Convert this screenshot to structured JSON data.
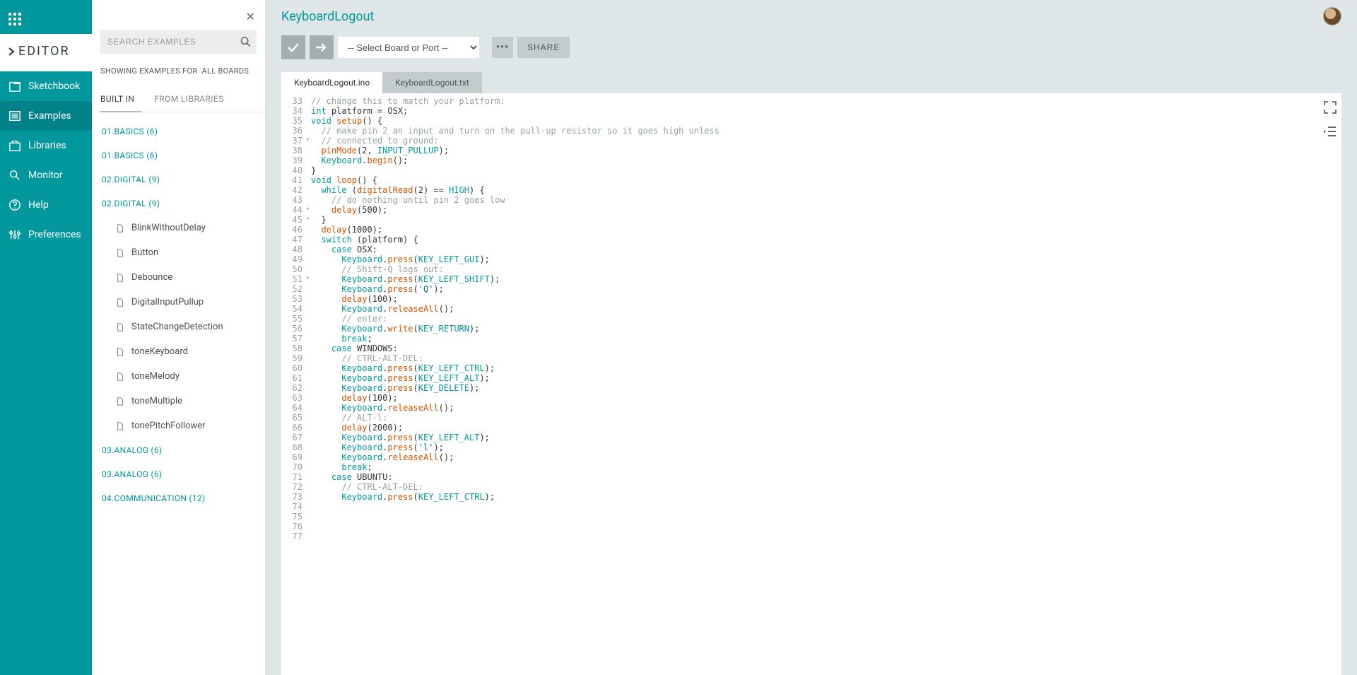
{
  "brand": "EDITOR",
  "nav": [
    {
      "id": "sketchbook",
      "label": "Sketchbook"
    },
    {
      "id": "examples",
      "label": "Examples"
    },
    {
      "id": "libraries",
      "label": "Libraries"
    },
    {
      "id": "monitor",
      "label": "Monitor"
    },
    {
      "id": "help",
      "label": "Help"
    },
    {
      "id": "preferences",
      "label": "Preferences"
    }
  ],
  "nav_active": "examples",
  "search": {
    "placeholder": "SEARCH EXAMPLES"
  },
  "showing": {
    "prefix": "SHOWING EXAMPLES FOR",
    "target": "ALL BOARDS"
  },
  "panel_tabs": {
    "builtin": "BUILT IN",
    "fromlib": "FROM LIBRARIES",
    "active": "builtin"
  },
  "tree": [
    {
      "type": "cat",
      "label": "01.BASICS (6)"
    },
    {
      "type": "cat",
      "label": "01.BASICS (6)"
    },
    {
      "type": "cat",
      "label": "02.DIGITAL (9)"
    },
    {
      "type": "cat",
      "label": "02.DIGITAL (9)"
    },
    {
      "type": "leaf",
      "label": "BlinkWithoutDelay"
    },
    {
      "type": "leaf",
      "label": "Button"
    },
    {
      "type": "leaf",
      "label": "Debounce"
    },
    {
      "type": "leaf",
      "label": "DigitalInputPullup"
    },
    {
      "type": "leaf",
      "label": "StateChangeDetection"
    },
    {
      "type": "leaf",
      "label": "toneKeyboard"
    },
    {
      "type": "leaf",
      "label": "toneMelody"
    },
    {
      "type": "leaf",
      "label": "toneMultiple"
    },
    {
      "type": "leaf",
      "label": "tonePitchFollower"
    },
    {
      "type": "cat",
      "label": "03.ANALOG (6)"
    },
    {
      "type": "cat",
      "label": "03.ANALOG (6)"
    },
    {
      "type": "cat",
      "label": "04.COMMUNICATION (12)"
    }
  ],
  "title": "KeyboardLogout",
  "board_select": "-- Select Board or Port --",
  "share_label": "SHARE",
  "file_tabs": [
    {
      "id": "ino",
      "label": "KeyboardLogout.ino"
    },
    {
      "id": "txt",
      "label": "KeyboardLogout.txt"
    }
  ],
  "file_tab_active": "ino",
  "code": {
    "first_line": 33,
    "fold_lines": [
      37,
      44,
      45,
      51
    ],
    "lines": [
      {
        "n": 33,
        "t": [
          [
            "",
            ""
          ]
        ]
      },
      {
        "n": 34,
        "t": [
          [
            "c-comment",
            "// change this to match your platform:"
          ]
        ]
      },
      {
        "n": 35,
        "t": [
          [
            "c-type",
            "int"
          ],
          [
            "",
            " platform = OSX;"
          ]
        ]
      },
      {
        "n": 36,
        "t": [
          [
            "",
            ""
          ]
        ]
      },
      {
        "n": 37,
        "t": [
          [
            "c-type",
            "void"
          ],
          [
            "",
            " "
          ],
          [
            "c-func",
            "setup"
          ],
          [
            "",
            "() {"
          ]
        ]
      },
      {
        "n": 38,
        "t": [
          [
            "",
            "  "
          ],
          [
            "c-comment",
            "// make pin 2 an input and turn on the pull-up resistor so it goes high unless"
          ]
        ]
      },
      {
        "n": 39,
        "t": [
          [
            "",
            "  "
          ],
          [
            "c-comment",
            "// connected to ground:"
          ]
        ]
      },
      {
        "n": 40,
        "t": [
          [
            "",
            "  "
          ],
          [
            "c-func",
            "pinMode"
          ],
          [
            "",
            "(2, "
          ],
          [
            "c-const",
            "INPUT_PULLUP"
          ],
          [
            "",
            ");"
          ]
        ]
      },
      {
        "n": 41,
        "t": [
          [
            "",
            "  "
          ],
          [
            "c-const",
            "Keyboard"
          ],
          [
            "",
            "."
          ],
          [
            "c-func",
            "begin"
          ],
          [
            "",
            "();"
          ]
        ]
      },
      {
        "n": 42,
        "t": [
          [
            "",
            "}"
          ]
        ]
      },
      {
        "n": 43,
        "t": [
          [
            "",
            ""
          ]
        ]
      },
      {
        "n": 44,
        "t": [
          [
            "c-type",
            "void"
          ],
          [
            "",
            " "
          ],
          [
            "c-func",
            "loop"
          ],
          [
            "",
            "() {"
          ]
        ]
      },
      {
        "n": 45,
        "t": [
          [
            "",
            "  "
          ],
          [
            "c-keyword",
            "while"
          ],
          [
            "",
            " ("
          ],
          [
            "c-func",
            "digitalRead"
          ],
          [
            "",
            "(2) == "
          ],
          [
            "c-const",
            "HIGH"
          ],
          [
            "",
            ") {"
          ]
        ]
      },
      {
        "n": 46,
        "t": [
          [
            "",
            "    "
          ],
          [
            "c-comment",
            "// do nothing until pin 2 goes low"
          ]
        ]
      },
      {
        "n": 47,
        "t": [
          [
            "",
            "    "
          ],
          [
            "c-func",
            "delay"
          ],
          [
            "",
            "(500);"
          ]
        ]
      },
      {
        "n": 48,
        "t": [
          [
            "",
            "  }"
          ]
        ]
      },
      {
        "n": 49,
        "t": [
          [
            "",
            "  "
          ],
          [
            "c-func",
            "delay"
          ],
          [
            "",
            "(1000);"
          ]
        ]
      },
      {
        "n": 50,
        "t": [
          [
            "",
            ""
          ]
        ]
      },
      {
        "n": 51,
        "t": [
          [
            "",
            "  "
          ],
          [
            "c-keyword",
            "switch"
          ],
          [
            "",
            " (platform) {"
          ]
        ]
      },
      {
        "n": 52,
        "t": [
          [
            "",
            "    "
          ],
          [
            "c-keyword",
            "case"
          ],
          [
            "",
            " OSX:"
          ]
        ]
      },
      {
        "n": 53,
        "t": [
          [
            "",
            "      "
          ],
          [
            "c-const",
            "Keyboard"
          ],
          [
            "",
            "."
          ],
          [
            "c-func",
            "press"
          ],
          [
            "",
            "("
          ],
          [
            "c-const",
            "KEY_LEFT_GUI"
          ],
          [
            "",
            ");"
          ]
        ]
      },
      {
        "n": 54,
        "t": [
          [
            "",
            "      "
          ],
          [
            "c-comment",
            "// Shift-Q logs out:"
          ]
        ]
      },
      {
        "n": 55,
        "t": [
          [
            "",
            "      "
          ],
          [
            "c-const",
            "Keyboard"
          ],
          [
            "",
            "."
          ],
          [
            "c-func",
            "press"
          ],
          [
            "",
            "("
          ],
          [
            "c-const",
            "KEY_LEFT_SHIFT"
          ],
          [
            "",
            ");"
          ]
        ]
      },
      {
        "n": 56,
        "t": [
          [
            "",
            "      "
          ],
          [
            "c-const",
            "Keyboard"
          ],
          [
            "",
            "."
          ],
          [
            "c-func",
            "press"
          ],
          [
            "",
            "("
          ],
          [
            "c-string",
            "'Q'"
          ],
          [
            "",
            ");"
          ]
        ]
      },
      {
        "n": 57,
        "t": [
          [
            "",
            "      "
          ],
          [
            "c-func",
            "delay"
          ],
          [
            "",
            "(100);"
          ]
        ]
      },
      {
        "n": 58,
        "t": [
          [
            "",
            "      "
          ],
          [
            "c-const",
            "Keyboard"
          ],
          [
            "",
            "."
          ],
          [
            "c-func",
            "releaseAll"
          ],
          [
            "",
            "();"
          ]
        ]
      },
      {
        "n": 59,
        "t": [
          [
            "",
            "      "
          ],
          [
            "c-comment",
            "// enter:"
          ]
        ]
      },
      {
        "n": 60,
        "t": [
          [
            "",
            "      "
          ],
          [
            "c-const",
            "Keyboard"
          ],
          [
            "",
            "."
          ],
          [
            "c-func",
            "write"
          ],
          [
            "",
            "("
          ],
          [
            "c-const",
            "KEY_RETURN"
          ],
          [
            "",
            ");"
          ]
        ]
      },
      {
        "n": 61,
        "t": [
          [
            "",
            "      "
          ],
          [
            "c-keyword",
            "break"
          ],
          [
            "",
            ";"
          ]
        ]
      },
      {
        "n": 62,
        "t": [
          [
            "",
            "    "
          ],
          [
            "c-keyword",
            "case"
          ],
          [
            "",
            " WINDOWS:"
          ]
        ]
      },
      {
        "n": 63,
        "t": [
          [
            "",
            "      "
          ],
          [
            "c-comment",
            "// CTRL-ALT-DEL:"
          ]
        ]
      },
      {
        "n": 64,
        "t": [
          [
            "",
            "      "
          ],
          [
            "c-const",
            "Keyboard"
          ],
          [
            "",
            "."
          ],
          [
            "c-func",
            "press"
          ],
          [
            "",
            "("
          ],
          [
            "c-const",
            "KEY_LEFT_CTRL"
          ],
          [
            "",
            ");"
          ]
        ]
      },
      {
        "n": 65,
        "t": [
          [
            "",
            "      "
          ],
          [
            "c-const",
            "Keyboard"
          ],
          [
            "",
            "."
          ],
          [
            "c-func",
            "press"
          ],
          [
            "",
            "("
          ],
          [
            "c-const",
            "KEY_LEFT_ALT"
          ],
          [
            "",
            ");"
          ]
        ]
      },
      {
        "n": 66,
        "t": [
          [
            "",
            "      "
          ],
          [
            "c-const",
            "Keyboard"
          ],
          [
            "",
            "."
          ],
          [
            "c-func",
            "press"
          ],
          [
            "",
            "("
          ],
          [
            "c-const",
            "KEY_DELETE"
          ],
          [
            "",
            ");"
          ]
        ]
      },
      {
        "n": 67,
        "t": [
          [
            "",
            "      "
          ],
          [
            "c-func",
            "delay"
          ],
          [
            "",
            "(100);"
          ]
        ]
      },
      {
        "n": 68,
        "t": [
          [
            "",
            "      "
          ],
          [
            "c-const",
            "Keyboard"
          ],
          [
            "",
            "."
          ],
          [
            "c-func",
            "releaseAll"
          ],
          [
            "",
            "();"
          ]
        ]
      },
      {
        "n": 69,
        "t": [
          [
            "",
            "      "
          ],
          [
            "c-comment",
            "// ALT-l:"
          ]
        ]
      },
      {
        "n": 70,
        "t": [
          [
            "",
            "      "
          ],
          [
            "c-func",
            "delay"
          ],
          [
            "",
            "(2000);"
          ]
        ]
      },
      {
        "n": 71,
        "t": [
          [
            "",
            "      "
          ],
          [
            "c-const",
            "Keyboard"
          ],
          [
            "",
            "."
          ],
          [
            "c-func",
            "press"
          ],
          [
            "",
            "("
          ],
          [
            "c-const",
            "KEY_LEFT_ALT"
          ],
          [
            "",
            ");"
          ]
        ]
      },
      {
        "n": 72,
        "t": [
          [
            "",
            "      "
          ],
          [
            "c-const",
            "Keyboard"
          ],
          [
            "",
            "."
          ],
          [
            "c-func",
            "press"
          ],
          [
            "",
            "("
          ],
          [
            "c-string",
            "'l'"
          ],
          [
            "",
            ");"
          ]
        ]
      },
      {
        "n": 73,
        "t": [
          [
            "",
            "      "
          ],
          [
            "c-const",
            "Keyboard"
          ],
          [
            "",
            "."
          ],
          [
            "c-func",
            "releaseAll"
          ],
          [
            "",
            "();"
          ]
        ]
      },
      {
        "n": 74,
        "t": [
          [
            "",
            "      "
          ],
          [
            "c-keyword",
            "break"
          ],
          [
            "",
            ";"
          ]
        ]
      },
      {
        "n": 75,
        "t": [
          [
            "",
            "    "
          ],
          [
            "c-keyword",
            "case"
          ],
          [
            "",
            " UBUNTU:"
          ]
        ]
      },
      {
        "n": 76,
        "t": [
          [
            "",
            "      "
          ],
          [
            "c-comment",
            "// CTRL-ALT-DEL:"
          ]
        ]
      },
      {
        "n": 77,
        "t": [
          [
            "",
            "      "
          ],
          [
            "c-const",
            "Keyboard"
          ],
          [
            "",
            "."
          ],
          [
            "c-func",
            "press"
          ],
          [
            "",
            "("
          ],
          [
            "c-const",
            "KEY_LEFT_CTRL"
          ],
          [
            "",
            ");"
          ]
        ]
      }
    ]
  }
}
